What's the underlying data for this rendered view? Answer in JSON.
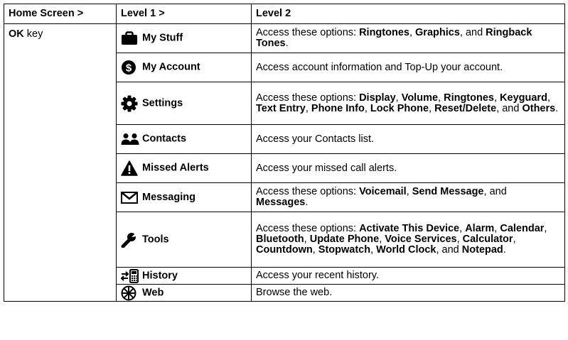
{
  "headers": {
    "home": "Home Screen >",
    "level1": "Level 1 >",
    "level2": "Level 2"
  },
  "ok_key": {
    "bold": "OK",
    "rest": " key"
  },
  "rows": [
    {
      "icon": "briefcase-icon",
      "label": "My Stuff",
      "desc": [
        {
          "t": "Access these options: "
        },
        {
          "t": "Ringtones",
          "b": true
        },
        {
          "t": ", "
        },
        {
          "t": "Graphics",
          "b": true
        },
        {
          "t": ", and "
        },
        {
          "t": "Ringback Tones",
          "b": true
        },
        {
          "t": "."
        }
      ]
    },
    {
      "icon": "dollar-icon",
      "label": "My Account",
      "desc": [
        {
          "t": "Access account information and Top-Up your account."
        }
      ]
    },
    {
      "icon": "gear-icon",
      "label": "Settings",
      "desc": [
        {
          "t": "Access these options: "
        },
        {
          "t": "Display",
          "b": true
        },
        {
          "t": ", "
        },
        {
          "t": "Volume",
          "b": true
        },
        {
          "t": ", "
        },
        {
          "t": "Ringtones",
          "b": true
        },
        {
          "t": ", "
        },
        {
          "t": "Keyguard",
          "b": true
        },
        {
          "t": ", "
        },
        {
          "t": "Text Entry",
          "b": true
        },
        {
          "t": ", "
        },
        {
          "t": "Phone Info",
          "b": true
        },
        {
          "t": ", "
        },
        {
          "t": "Lock Phone",
          "b": true
        },
        {
          "t": ", "
        },
        {
          "t": "Reset/Delete",
          "b": true
        },
        {
          "t": ", and "
        },
        {
          "t": "Others",
          "b": true
        },
        {
          "t": "."
        }
      ]
    },
    {
      "icon": "contacts-icon",
      "label": "Contacts",
      "desc": [
        {
          "t": "Access your Contacts list."
        }
      ]
    },
    {
      "icon": "alert-icon",
      "label": "Missed Alerts",
      "desc": [
        {
          "t": "Access your missed call alerts."
        }
      ]
    },
    {
      "icon": "envelope-icon",
      "label": "Messaging",
      "desc": [
        {
          "t": "Access these options: "
        },
        {
          "t": "Voicemail",
          "b": true
        },
        {
          "t": ", "
        },
        {
          "t": "Send Message",
          "b": true
        },
        {
          "t": ", and "
        },
        {
          "t": "Messages",
          "b": true
        },
        {
          "t": "."
        }
      ]
    },
    {
      "icon": "wrench-icon",
      "label": "Tools",
      "desc": [
        {
          "t": "Access these options: "
        },
        {
          "t": "Activate This Device",
          "b": true
        },
        {
          "t": ", "
        },
        {
          "t": "Alarm",
          "b": true
        },
        {
          "t": ", "
        },
        {
          "t": "Calendar",
          "b": true
        },
        {
          "t": ", "
        },
        {
          "t": "Bluetooth",
          "b": true
        },
        {
          "t": ", "
        },
        {
          "t": "Update Phone",
          "b": true
        },
        {
          "t": ", "
        },
        {
          "t": "Voice Services",
          "b": true
        },
        {
          "t": ", "
        },
        {
          "t": "Calculator",
          "b": true
        },
        {
          "t": ", "
        },
        {
          "t": "Countdown",
          "b": true
        },
        {
          "t": ", "
        },
        {
          "t": "Stopwatch",
          "b": true
        },
        {
          "t": ", "
        },
        {
          "t": "World Clock",
          "b": true
        },
        {
          "t": ", and "
        },
        {
          "t": "Notepad",
          "b": true
        },
        {
          "t": "."
        }
      ]
    },
    {
      "icon": "history-icon",
      "label": "History",
      "desc": [
        {
          "t": "Access your recent history."
        }
      ]
    },
    {
      "icon": "globe-icon",
      "label": "Web",
      "desc": [
        {
          "t": "Browse the web."
        }
      ]
    }
  ]
}
